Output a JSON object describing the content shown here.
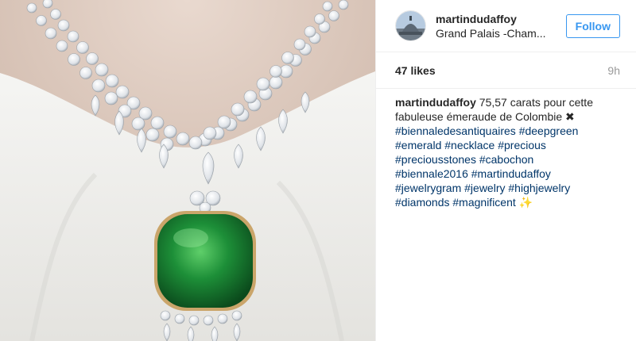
{
  "post": {
    "username": "martindudaffoy",
    "location": "Grand Palais -Cham...",
    "follow_label": "Follow",
    "likes": "47 likes",
    "time_ago": "9h",
    "caption": {
      "author": "martindudaffoy",
      "text_line1": "75,57 carats pour cette",
      "text_line2": "fabuleuse émeraude de Colombie",
      "clover_emoji": "✖",
      "sparkle_emoji": "✨",
      "hashtags": [
        "#biennaledesantiquaires",
        "#deepgreen",
        "#emerald",
        "#necklace",
        "#precious",
        "#preciousstones",
        "#cabochon",
        "#biennale2016",
        "#martindudaffoy",
        "#jewelrygram",
        "#jewelry",
        "#highjewelry",
        "#diamonds",
        "#magnificent"
      ]
    }
  },
  "colors": {
    "link_blue": "#3897f0",
    "hashtag_navy": "#003569",
    "text_dark": "#262626",
    "text_gray": "#999999",
    "emerald": "#1f8a3a"
  },
  "icons": {
    "avatar": "avatar-grand-palais-photo",
    "clover": "four-leaf-clover-icon",
    "sparkle": "sparkles-icon"
  }
}
